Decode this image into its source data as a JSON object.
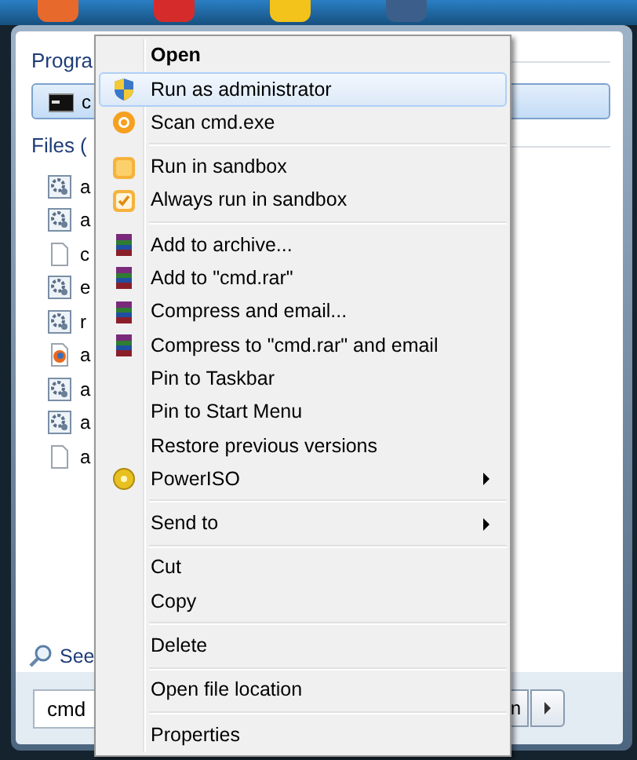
{
  "start_menu": {
    "sections": [
      {
        "heading": "Progra",
        "items": [
          {
            "label": "c",
            "kind": "console",
            "selected": true
          }
        ]
      },
      {
        "heading": "Files (",
        "items": [
          {
            "label": "a",
            "kind": "gear",
            "selected": false
          },
          {
            "label": "a",
            "kind": "gear",
            "selected": false
          },
          {
            "label": "c",
            "kind": "page",
            "selected": false
          },
          {
            "label": "e",
            "kind": "gear",
            "selected": false
          },
          {
            "label": "r",
            "kind": "gear",
            "selected": false
          },
          {
            "label": "a",
            "kind": "web",
            "selected": false
          },
          {
            "label": "a",
            "kind": "gear",
            "selected": false
          },
          {
            "label": "a",
            "kind": "gear",
            "selected": false
          },
          {
            "label": "a",
            "kind": "page",
            "selected": false
          }
        ]
      }
    ],
    "see_more": "See",
    "search": {
      "value": "cmd"
    },
    "shutdown": {
      "label": "n"
    }
  },
  "context_menu": [
    {
      "kind": "plain",
      "label": "Open",
      "default": true,
      "selected": false
    },
    {
      "kind": "shield",
      "label": "Run as administrator",
      "selected": true
    },
    {
      "kind": "scan",
      "label": "Scan cmd.exe",
      "selected": false
    },
    {
      "kind": "separator"
    },
    {
      "kind": "sandbox",
      "label": "Run in sandbox",
      "selected": false
    },
    {
      "kind": "sandbox-check",
      "label": "Always run in sandbox",
      "selected": false
    },
    {
      "kind": "separator"
    },
    {
      "kind": "archive",
      "label": "Add to archive...",
      "selected": false
    },
    {
      "kind": "archive",
      "label": "Add to \"cmd.rar\"",
      "selected": false
    },
    {
      "kind": "archive",
      "label": "Compress and email...",
      "selected": false
    },
    {
      "kind": "archive",
      "label": "Compress to \"cmd.rar\" and email",
      "selected": false
    },
    {
      "kind": "plain",
      "label": "Pin to Taskbar",
      "selected": false
    },
    {
      "kind": "plain",
      "label": "Pin to Start Menu",
      "selected": false
    },
    {
      "kind": "plain",
      "label": "Restore previous versions",
      "selected": false
    },
    {
      "kind": "disc",
      "label": "PowerISO",
      "submenu": true,
      "selected": false
    },
    {
      "kind": "separator"
    },
    {
      "kind": "plain",
      "label": "Send to",
      "submenu": true,
      "selected": false
    },
    {
      "kind": "separator"
    },
    {
      "kind": "plain",
      "label": "Cut",
      "selected": false
    },
    {
      "kind": "plain",
      "label": "Copy",
      "selected": false
    },
    {
      "kind": "separator"
    },
    {
      "kind": "plain",
      "label": "Delete",
      "selected": false
    },
    {
      "kind": "separator"
    },
    {
      "kind": "plain",
      "label": "Open file location",
      "selected": false
    },
    {
      "kind": "separator"
    },
    {
      "kind": "plain",
      "label": "Properties",
      "selected": false
    }
  ]
}
